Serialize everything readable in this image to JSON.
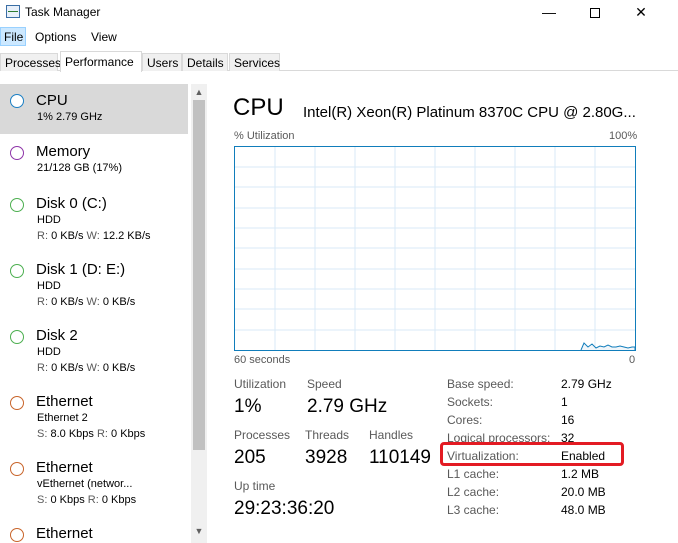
{
  "window": {
    "title": "Task Manager"
  },
  "menu": [
    "File",
    "Options",
    "View"
  ],
  "tabs": [
    "Processes",
    "Performance",
    "Users",
    "Details",
    "Services"
  ],
  "sidebar": [
    {
      "title": "CPU",
      "line1": "1% 2.79 GHz",
      "circle_color": "#1b7fc4",
      "selected": true
    },
    {
      "title": "Memory",
      "line1": "21/128 GB (17%)",
      "circle_color": "#8e34a8"
    },
    {
      "title": "Disk 0 (C:)",
      "line1": "HDD",
      "line2_r": "R:",
      "line2_rv": "0 KB/s",
      "line2_w": "W:",
      "line2_wv": "12.2 KB/s",
      "circle_color": "#4caf50"
    },
    {
      "title": "Disk 1 (D: E:)",
      "line1": "HDD",
      "line2_r": "R:",
      "line2_rv": "0 KB/s",
      "line2_w": "W:",
      "line2_wv": "0 KB/s",
      "circle_color": "#4caf50"
    },
    {
      "title": "Disk 2",
      "line1": "HDD",
      "line2_r": "R:",
      "line2_rv": "0 KB/s",
      "line2_w": "W:",
      "line2_wv": "0 KB/s",
      "circle_color": "#4caf50"
    },
    {
      "title": "Ethernet",
      "line1": "Ethernet 2",
      "line2_r": "S:",
      "line2_rv": "8.0 Kbps",
      "line2_w": "R:",
      "line2_wv": "0 Kbps",
      "circle_color": "#c8642a"
    },
    {
      "title": "Ethernet",
      "line1": "vEthernet (networ...",
      "line2_r": "S:",
      "line2_rv": "0 Kbps",
      "line2_w": "R:",
      "line2_wv": "0 Kbps",
      "circle_color": "#c8642a"
    },
    {
      "title": "Ethernet",
      "circle_color": "#c8642a"
    }
  ],
  "main": {
    "title": "CPU",
    "cpu_name": "Intel(R) Xeon(R) Platinum 8370C CPU @ 2.80G...",
    "graph": {
      "y_label": "% Utilization",
      "y_max_label": "100%",
      "x_label": "60 seconds",
      "x_min_label": "0"
    },
    "utilization_label": "Utilization",
    "utilization_value": "1%",
    "speed_label": "Speed",
    "speed_value": "2.79 GHz",
    "processes_label": "Processes",
    "processes_value": "205",
    "threads_label": "Threads",
    "threads_value": "3928",
    "handles_label": "Handles",
    "handles_value": "110149",
    "uptime_label": "Up time",
    "uptime_value": "29:23:36:20",
    "info": [
      {
        "label": "Base speed:",
        "value": "2.79 GHz"
      },
      {
        "label": "Sockets:",
        "value": "1"
      },
      {
        "label": "Cores:",
        "value": "16"
      },
      {
        "label": "Logical processors:",
        "value": "32"
      },
      {
        "label": "Virtualization:",
        "value": "Enabled"
      },
      {
        "label": "L1 cache:",
        "value": "1.2 MB"
      },
      {
        "label": "L2 cache:",
        "value": "20.0 MB"
      },
      {
        "label": "L3 cache:",
        "value": "48.0 MB"
      }
    ]
  },
  "colors": {
    "graph_border": "#117dbb",
    "highlight": "#e31b23"
  }
}
